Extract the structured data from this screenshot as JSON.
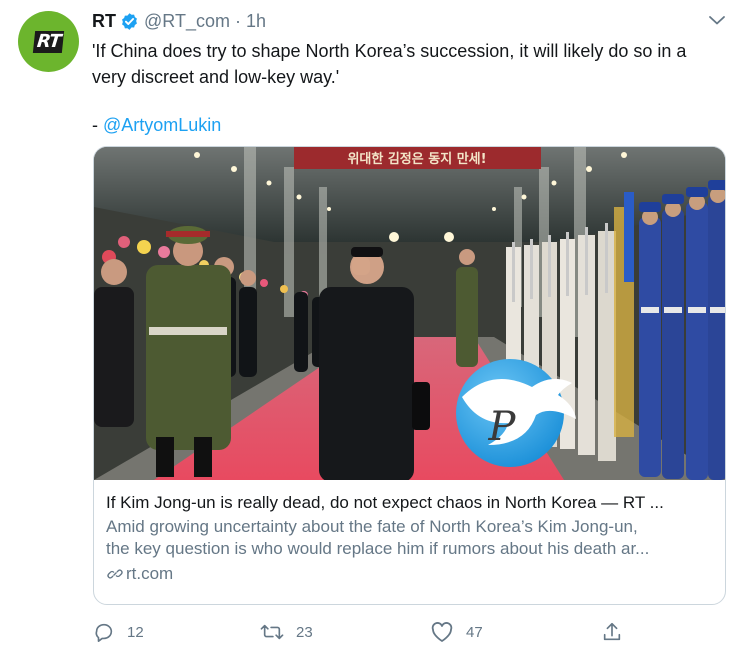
{
  "tweet": {
    "author_name": "RT",
    "handle": "@RT_com",
    "separator": "·",
    "time": "1h",
    "avatar_text": "RT",
    "text_line": "'If China does try to shape North Korea’s succession, it will likely do so in a very discreet and low-key way.'",
    "credit_prefix": "- ",
    "credit_mention": "@ArtyomLukin"
  },
  "card": {
    "banner_text": "위대한 김정은 동지 만세!",
    "title": "If Kim Jong-un is really dead, do not expect chaos in North Korea — RT ...",
    "description_line1": "Amid growing uncertainty about the fate of North Korea’s Kim Jong-un,",
    "description_line2": "the key question is who would replace him if rumors about his death ar...",
    "domain": "rt.com",
    "watermark_letter": "P"
  },
  "actions": {
    "reply_count": "12",
    "retweet_count": "23",
    "like_count": "47"
  },
  "colors": {
    "accent": "#1da1f2",
    "secondary_text": "#657786",
    "avatar_bg": "#6cb52d",
    "carpet": "#e5475e"
  }
}
